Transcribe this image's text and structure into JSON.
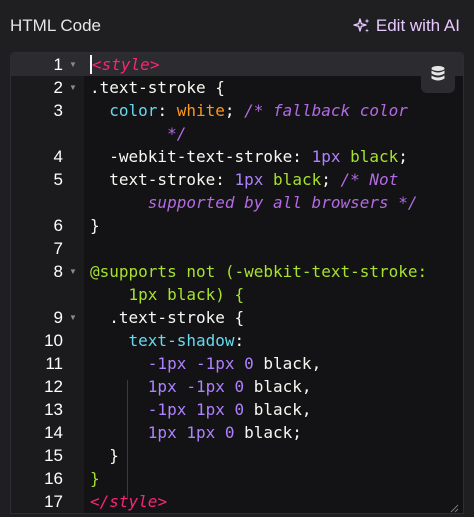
{
  "header": {
    "title": "HTML Code",
    "ai_label": "Edit with AI"
  },
  "editor": {
    "lines": [
      {
        "n": "1",
        "fold": true,
        "active": true,
        "tokens": [
          {
            "t": "<",
            "c": "tag"
          },
          {
            "t": "style",
            "c": "tagname"
          },
          {
            "t": ">",
            "c": "tag"
          }
        ]
      },
      {
        "n": "2",
        "fold": true,
        "tokens": [
          {
            "t": ".text-stroke {",
            "c": "sel"
          }
        ]
      },
      {
        "n": "3",
        "tokens": [
          {
            "t": "  ",
            "c": "plain"
          },
          {
            "t": "color",
            "c": "prop"
          },
          {
            "t": ": ",
            "c": "plain"
          },
          {
            "t": "white",
            "c": "val"
          },
          {
            "t": "; ",
            "c": "plain"
          },
          {
            "t": "/* fallback color\n        */",
            "c": "comment"
          }
        ]
      },
      {
        "n": "4",
        "tokens": [
          {
            "t": "  -webkit-text-stroke: ",
            "c": "plain"
          },
          {
            "t": "1px",
            "c": "num"
          },
          {
            "t": " ",
            "c": "plain"
          },
          {
            "t": "black",
            "c": "kw"
          },
          {
            "t": ";",
            "c": "plain"
          }
        ]
      },
      {
        "n": "5",
        "tokens": [
          {
            "t": "  text-stroke: ",
            "c": "plain"
          },
          {
            "t": "1px",
            "c": "num"
          },
          {
            "t": " ",
            "c": "plain"
          },
          {
            "t": "black",
            "c": "kw"
          },
          {
            "t": "; ",
            "c": "plain"
          },
          {
            "t": "/* Not\n      supported by all browsers */",
            "c": "comment"
          }
        ]
      },
      {
        "n": "6",
        "tokens": [
          {
            "t": "}",
            "c": "plain"
          }
        ]
      },
      {
        "n": "7",
        "tokens": []
      },
      {
        "n": "8",
        "fold": true,
        "tokens": [
          {
            "t": "@supports not (-webkit-text-stroke:\n    ",
            "c": "kw"
          },
          {
            "t": "1px black) {",
            "c": "kw"
          }
        ]
      },
      {
        "n": "9",
        "fold": true,
        "tokens": [
          {
            "t": "  .text-stroke {",
            "c": "sel"
          }
        ]
      },
      {
        "n": "10",
        "tokens": [
          {
            "t": "    ",
            "c": "plain"
          },
          {
            "t": "text-shadow",
            "c": "prop"
          },
          {
            "t": ":",
            "c": "plain"
          }
        ]
      },
      {
        "n": "11",
        "tokens": [
          {
            "t": "      ",
            "c": "plain"
          },
          {
            "t": "-1px -1px 0",
            "c": "num"
          },
          {
            "t": " black,",
            "c": "plain"
          }
        ]
      },
      {
        "n": "12",
        "tokens": [
          {
            "t": "      ",
            "c": "plain"
          },
          {
            "t": "1px -1px 0",
            "c": "num"
          },
          {
            "t": " black,",
            "c": "plain"
          }
        ]
      },
      {
        "n": "13",
        "tokens": [
          {
            "t": "      ",
            "c": "plain"
          },
          {
            "t": "-1px 1px 0",
            "c": "num"
          },
          {
            "t": " black,",
            "c": "plain"
          }
        ]
      },
      {
        "n": "14",
        "tokens": [
          {
            "t": "      ",
            "c": "plain"
          },
          {
            "t": "1px 1px 0",
            "c": "num"
          },
          {
            "t": " black;",
            "c": "plain"
          }
        ]
      },
      {
        "n": "15",
        "tokens": [
          {
            "t": "  }",
            "c": "plain"
          }
        ]
      },
      {
        "n": "16",
        "tokens": [
          {
            "t": "}",
            "c": "kw"
          }
        ]
      },
      {
        "n": "17",
        "tokens": [
          {
            "t": "</",
            "c": "tag"
          },
          {
            "t": "style",
            "c": "tagname"
          },
          {
            "t": ">",
            "c": "tag"
          }
        ]
      }
    ]
  },
  "icons": {
    "ai": "sparkle-icon",
    "db": "database-icon",
    "resize": "resize-handle-icon"
  }
}
